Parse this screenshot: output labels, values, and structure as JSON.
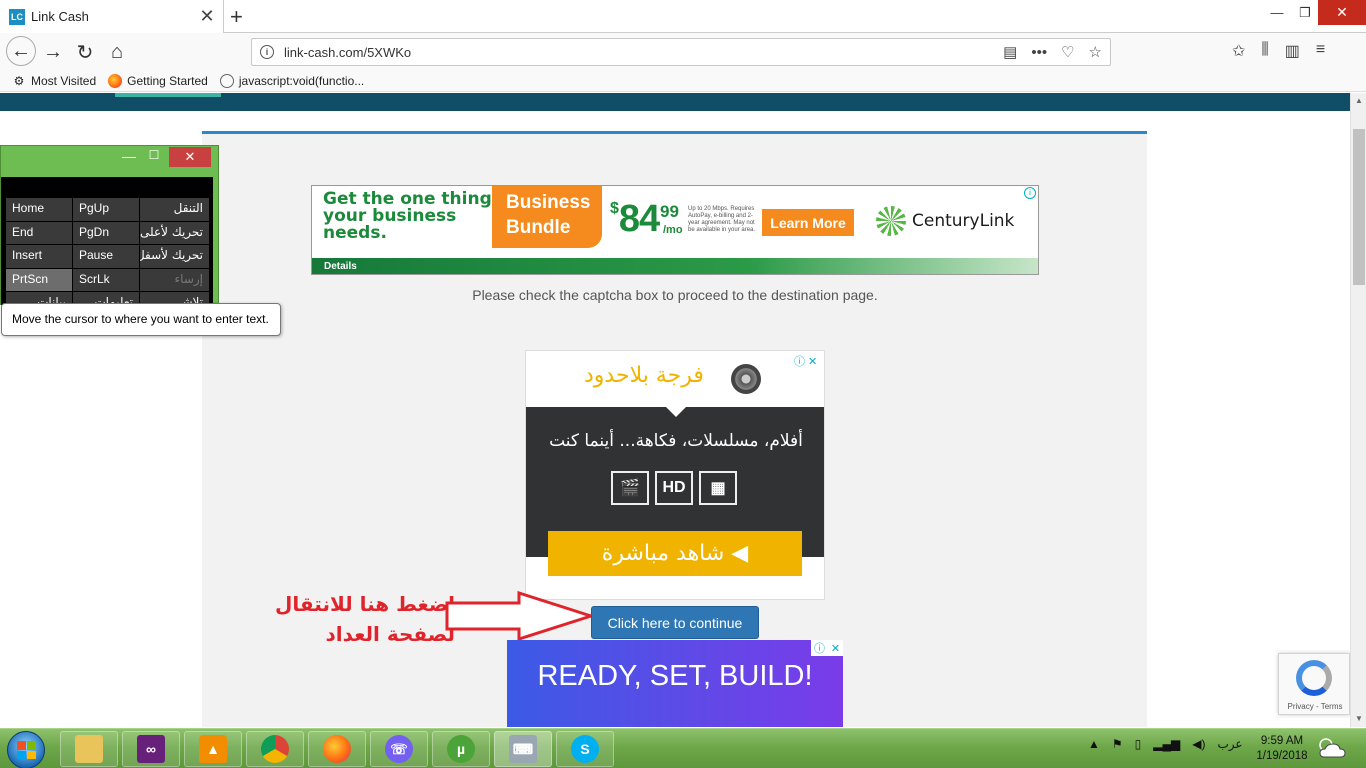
{
  "browser": {
    "tab_title": "Link Cash",
    "tab_favicon": "LC",
    "tab_close": "✕",
    "new_tab": "+",
    "url": "link-cash.com/5XWKo",
    "bookmarks": [
      "Most Visited",
      "Getting Started",
      "javascript:void(functio..."
    ]
  },
  "page": {
    "captcha_message": "Please check the captcha box to proceed to the destination page.",
    "continue_button": "Click here to continue",
    "annotation_line1": "اضغط هنا للانتقال",
    "annotation_line2": "لصفحة العداد"
  },
  "ad_centurylink": {
    "headline": "Get the one thing your business needs.",
    "bundle": "Business Bundle",
    "price_dollar": "$",
    "price_main": "84",
    "price_cents": "99",
    "price_period": "/mo",
    "fine_print": "Up to 20 Mbps. Requires AutoPay, e-billing and 2-year agreement. May not be available in your area.",
    "cta": "Learn More",
    "brand": "CenturyLink",
    "details": "Details"
  },
  "ad_arabic": {
    "brand": "فرجة بلاحدود",
    "tagline": "أفلام، مسلسلات، فكاهة... أينما كنت",
    "hd_label": "HD",
    "watch_button": "◀ شاهد مباشرة"
  },
  "ad_build": {
    "text": "READY, SET, BUILD!"
  },
  "recaptcha": {
    "links": "Privacy - Terms"
  },
  "osk": {
    "tooltip": "Move the cursor to where you want to enter text.",
    "keys": [
      [
        "Home",
        "PgUp",
        "التنقل"
      ],
      [
        "End",
        "PgDn",
        "تحريك لأعلى"
      ],
      [
        "Insert",
        "Pause",
        "تحريك لأسفل"
      ],
      [
        "PrtScn",
        "ScrLk",
        "إرساء"
      ],
      [
        "بيانات",
        "تعليمات",
        "تلاشي"
      ]
    ]
  },
  "taskbar": {
    "language": "عرب",
    "time": "9:59 AM",
    "date": "1/19/2018"
  },
  "colors": {
    "header": "#0f4e66",
    "panel_accent": "#2f86c6",
    "continue_button": "#2f77b4",
    "annotation": "#e0242b",
    "taskbar": "#6ea84a"
  }
}
